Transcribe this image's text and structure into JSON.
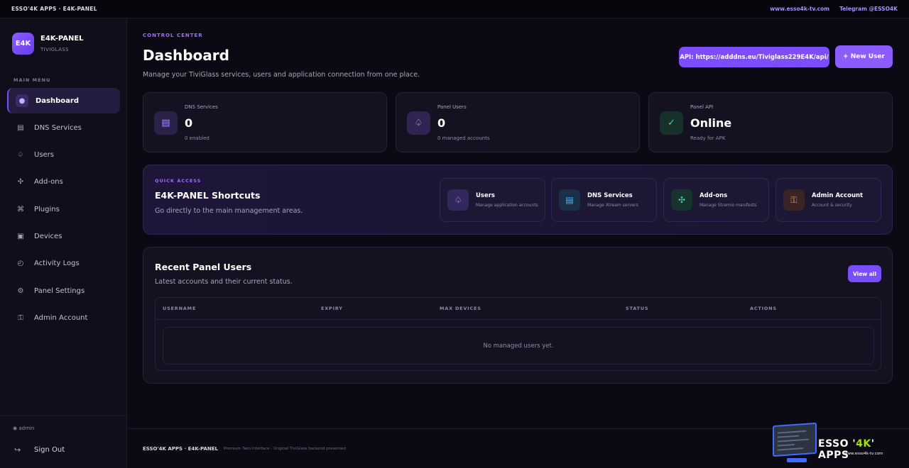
{
  "topbar": {
    "brand": "ESSO'4K APPS · E4K-PANEL",
    "website": "www.esso4k-tv.com",
    "telegram": "Telegram @ESSO4K"
  },
  "sidebar": {
    "logo": "E4K",
    "title": "E4K-PANEL",
    "subtitle": "TIVIGLASS",
    "menu_heading": "MAIN MENU",
    "items": [
      {
        "label": "Dashboard",
        "icon": "circle-icon",
        "glyph": "●",
        "active": true
      },
      {
        "label": "DNS Services",
        "icon": "server-icon",
        "glyph": "▤"
      },
      {
        "label": "Users",
        "icon": "user-icon",
        "glyph": "♤"
      },
      {
        "label": "Add-ons",
        "icon": "addons-icon",
        "glyph": "✣"
      },
      {
        "label": "Plugins",
        "icon": "plugin-icon",
        "glyph": "⌘"
      },
      {
        "label": "Devices",
        "icon": "device-icon",
        "glyph": "▣"
      },
      {
        "label": "Activity Logs",
        "icon": "clock-icon",
        "glyph": "◴"
      },
      {
        "label": "Panel Settings",
        "icon": "gear-icon",
        "glyph": "⚙"
      },
      {
        "label": "Admin Account",
        "icon": "admin-icon",
        "glyph": "⚿"
      }
    ],
    "admin_user": "◉ admin",
    "sign_out": "Sign Out"
  },
  "header": {
    "eyebrow": "CONTROL CENTER",
    "title": "Dashboard",
    "description": "Manage your TiviGlass services, users and application connection from one place.",
    "api_button": "API: https://adddns.eu/Tiviglass229E4K/api/",
    "new_user_button": "+ New User"
  },
  "stats": [
    {
      "label": "DNS Services",
      "value": "0",
      "sub": "0 enabled",
      "icon": "server-icon",
      "glyph": "▤",
      "color": "#a98cff",
      "bg": "#2a2148"
    },
    {
      "label": "Panel Users",
      "value": "0",
      "sub": "0 managed accounts",
      "icon": "user-icon",
      "glyph": "♤",
      "color": "#c9b8ff",
      "bg": "#2f2452"
    },
    {
      "label": "Panel API",
      "value": "Online",
      "sub": "Ready for APK",
      "icon": "check-icon",
      "glyph": "✓",
      "color": "#3ddc97",
      "bg": "#16302a"
    }
  ],
  "quick_access": {
    "eyebrow": "QUICK ACCESS",
    "title": "E4K-PANEL Shortcuts",
    "description": "Go directly to the main management areas.",
    "shortcuts": [
      {
        "title": "Users",
        "sub": "Manage application accounts",
        "icon": "user-icon",
        "glyph": "♤",
        "color": "#c9b8ff",
        "bg": "#33275c"
      },
      {
        "title": "DNS Services",
        "sub": "Manage Xtream servers",
        "icon": "server-icon",
        "glyph": "▤",
        "color": "#4fb8ff",
        "bg": "#1b2f48"
      },
      {
        "title": "Add-ons",
        "sub": "Manage Stremio manifests",
        "icon": "addons-icon",
        "glyph": "✣",
        "color": "#3ddc97",
        "bg": "#173330"
      },
      {
        "title": "Admin Account",
        "sub": "Account & security",
        "icon": "admin-icon",
        "glyph": "⚿",
        "color": "#ff9a4a",
        "bg": "#3a2524"
      }
    ]
  },
  "recent": {
    "title": "Recent Panel Users",
    "description": "Latest accounts and their current status.",
    "view_all": "View all",
    "columns": [
      "USERNAME",
      "EXPIRY",
      "MAX DEVICES",
      "STATUS",
      "ACTIONS"
    ],
    "empty": "No managed users yet."
  },
  "footer": {
    "brand": "ESSO'4K APPS · E4K-PANEL",
    "note": "Premium Twin Interface · Original TiviGlass backend preserved"
  },
  "watermark": {
    "title_a": "ESSO '",
    "title_b": "4K",
    "title_c": "' APPS",
    "url": "www.esso4k-tv.com"
  }
}
